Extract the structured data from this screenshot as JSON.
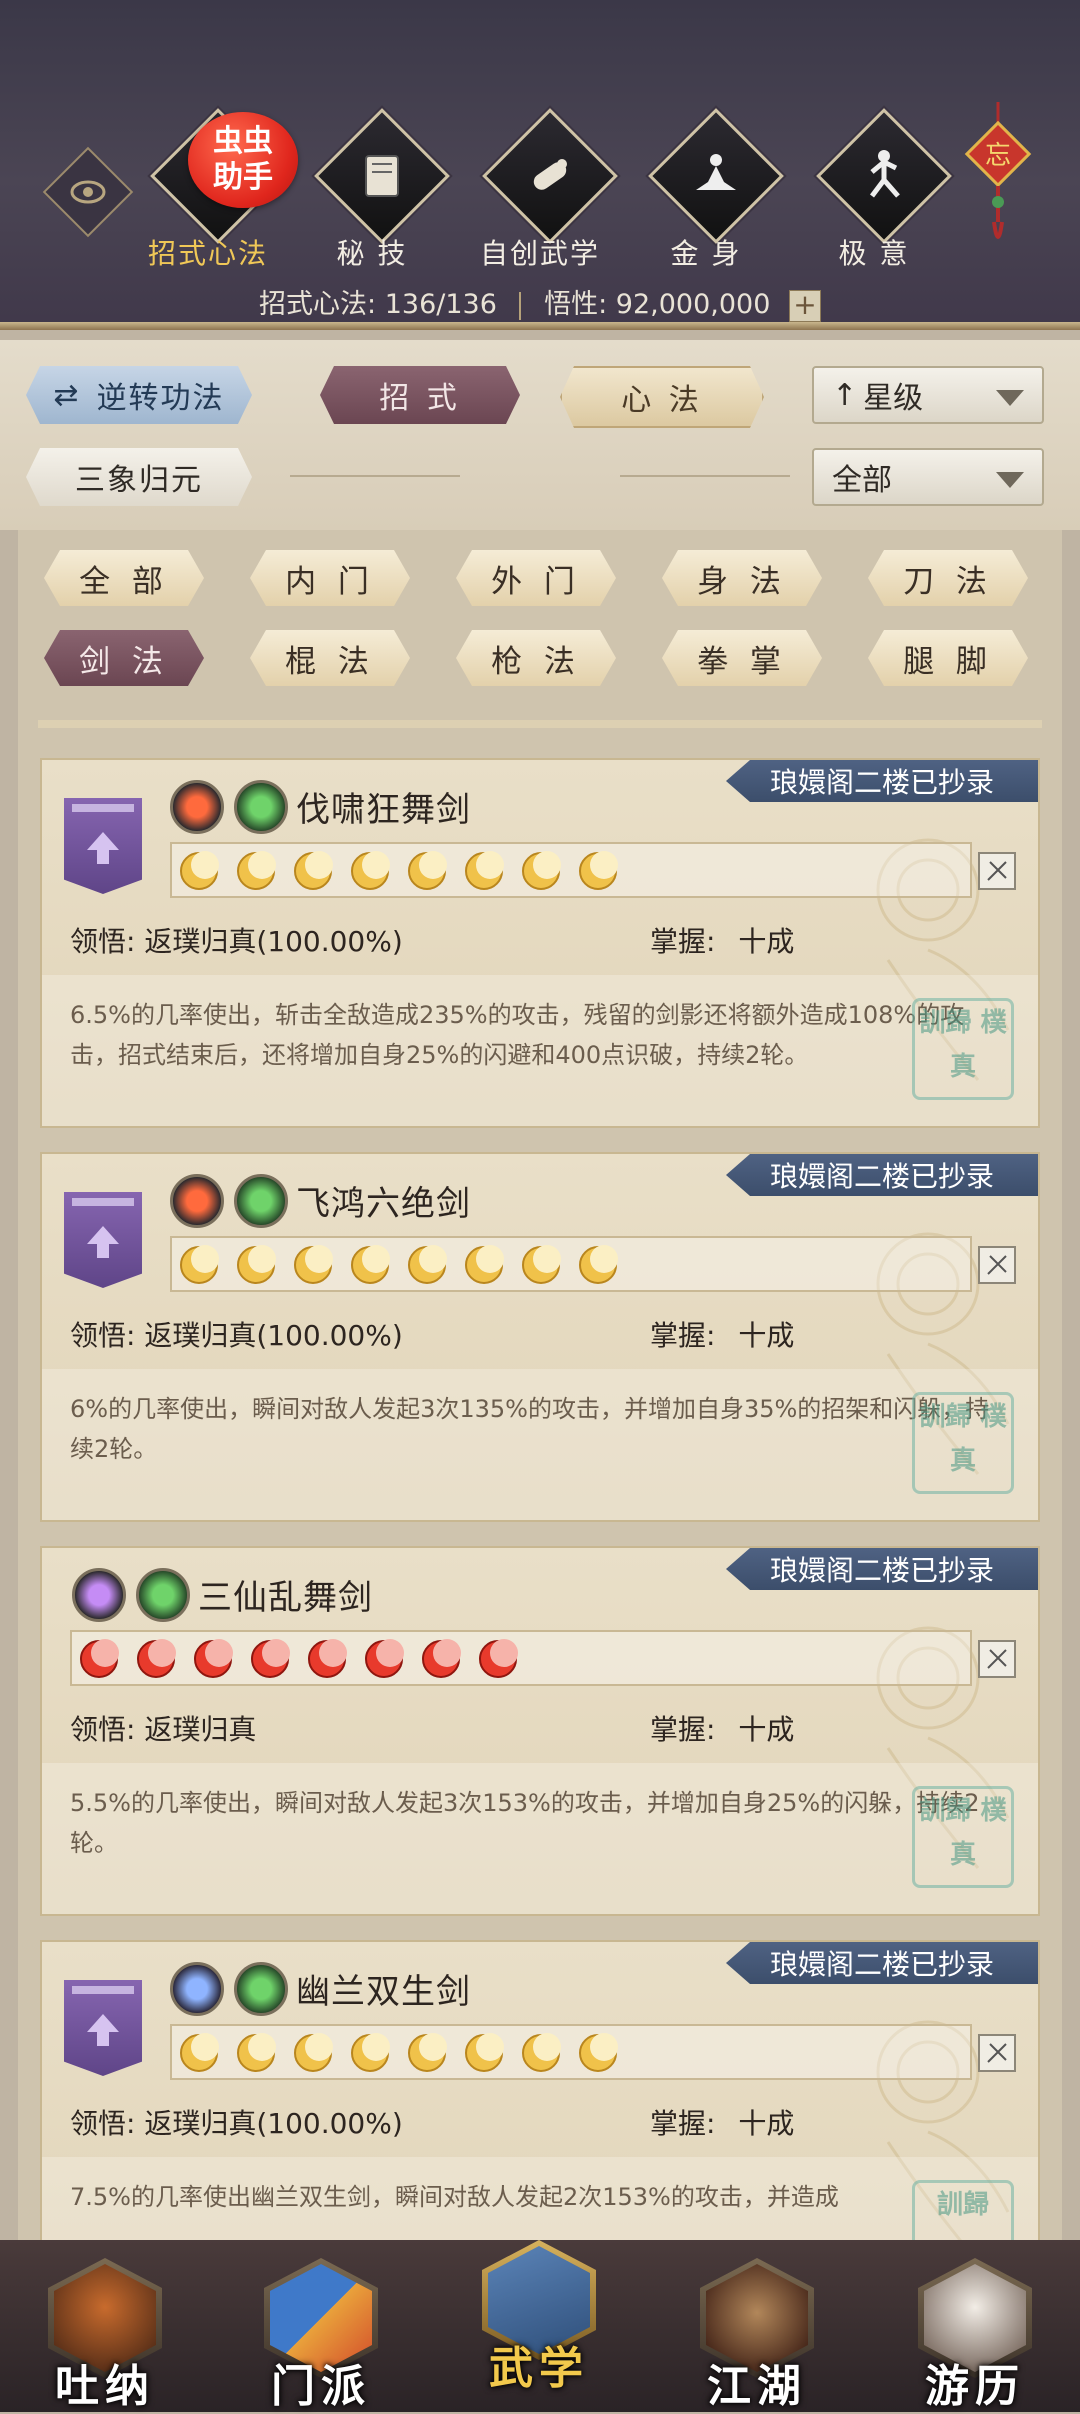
{
  "header": {
    "badge": {
      "line1": "虫虫",
      "line2": "助手"
    },
    "top_nav": [
      {
        "label": "招式心法",
        "icon": "sword-hand-icon",
        "active": true
      },
      {
        "label": "秘 技",
        "icon": "book-icon",
        "active": false
      },
      {
        "label": "自创武学",
        "icon": "scroll-icon",
        "active": false
      },
      {
        "label": "金 身",
        "icon": "meditation-icon",
        "active": false
      },
      {
        "label": "极 意",
        "icon": "kungfu-stance-icon",
        "active": false
      }
    ],
    "ornament_char": "忘",
    "stats": {
      "techniques_label": "招式心法:",
      "techniques_value": "136/136",
      "insight_label": "悟性:",
      "insight_value": "92,000,000",
      "plus": "+"
    }
  },
  "filters": {
    "reverse_label": "逆转功法",
    "tab_moves": "招 式",
    "tab_heart": "心 法",
    "sort_label": "星级",
    "sanxiang_label": "三象归元",
    "scope_label": "全部"
  },
  "categories": [
    {
      "label": "全 部",
      "active": false
    },
    {
      "label": "内 门",
      "active": false
    },
    {
      "label": "外 门",
      "active": false
    },
    {
      "label": "身 法",
      "active": false
    },
    {
      "label": "刀 法",
      "active": false
    },
    {
      "label": "剑 法",
      "active": true
    },
    {
      "label": "棍 法",
      "active": false
    },
    {
      "label": "枪 法",
      "active": false
    },
    {
      "label": "拳 掌",
      "active": false
    },
    {
      "label": "腿 脚",
      "active": false
    }
  ],
  "skills": [
    {
      "banner": "琅嬛阁二楼已抄录",
      "name": "伐啸狂舞剑",
      "has_rank_badge": true,
      "elements": [
        "fire-icon",
        "wind-blade-icon"
      ],
      "moon_color": "gold",
      "moon_count": 8,
      "weapon_icon": "sword-icon",
      "comprehension_label": "领悟:",
      "comprehension_value": "返璞归真(100.00%)",
      "mastery_label": "掌握:",
      "mastery_value": "十成",
      "description": "6.5%的几率使出，斩击全敌造成235%的攻击，残留的剑影还将额外造成108%的攻击，招式结束后，还将增加自身25%的闪避和400点识破，持续2轮。",
      "seal_text": "訓歸 樸真"
    },
    {
      "banner": "琅嬛阁二楼已抄录",
      "name": "飞鸿六绝剑",
      "has_rank_badge": true,
      "elements": [
        "fire-icon",
        "wind-blade-icon"
      ],
      "moon_color": "gold",
      "moon_count": 8,
      "weapon_icon": "sword-icon",
      "comprehension_label": "领悟:",
      "comprehension_value": "返璞归真(100.00%)",
      "mastery_label": "掌握:",
      "mastery_value": "十成",
      "description": "6%的几率使出，瞬间对敌人发起3次135%的攻击，并增加自身35%的招架和闪躲，持续2轮。",
      "seal_text": "訓歸 樸真"
    },
    {
      "banner": "琅嬛阁二楼已抄录",
      "name": "三仙乱舞剑",
      "has_rank_badge": false,
      "elements": [
        "lightning-icon",
        "wind-blade-icon"
      ],
      "moon_color": "red",
      "moon_count": 8,
      "weapon_icon": "crossed-swords-icon",
      "comprehension_label": "领悟:",
      "comprehension_value": "返璞归真",
      "mastery_label": "掌握:",
      "mastery_value": "十成",
      "description": "5.5%的几率使出，瞬间对敌人发起3次153%的攻击，并增加自身25%的闪躲，持续2轮。",
      "seal_text": "訓歸 樸真"
    },
    {
      "banner": "琅嬛阁二楼已抄录",
      "name": "幽兰双生剑",
      "has_rank_badge": true,
      "elements": [
        "snowflake-icon",
        "wind-blade-icon"
      ],
      "moon_color": "gold",
      "moon_count": 8,
      "weapon_icon": "crossed-swords-icon",
      "comprehension_label": "领悟:",
      "comprehension_value": "返璞归真(100.00%)",
      "mastery_label": "掌握:",
      "mastery_value": "十成",
      "description": "7.5%的几率使出幽兰双生剑，瞬间对敌人发起2次153%的攻击，并造成",
      "seal_text": "訓歸"
    }
  ],
  "bottom_nav": [
    {
      "label": "吐纳",
      "icon": "monk-icon",
      "active": false
    },
    {
      "label": "门派",
      "icon": "banner-flags-icon",
      "active": false
    },
    {
      "label": "武学",
      "icon": "book-stack-icon",
      "active": true
    },
    {
      "label": "江湖",
      "icon": "straw-hat-icon",
      "active": false
    },
    {
      "label": "游历",
      "icon": "horse-icon",
      "active": false
    }
  ],
  "colors": {
    "accent_gold": "#f0c857",
    "plum": "#6b4652",
    "banner_blue": "#4f6283",
    "rank_purple": "#6f51a0"
  }
}
